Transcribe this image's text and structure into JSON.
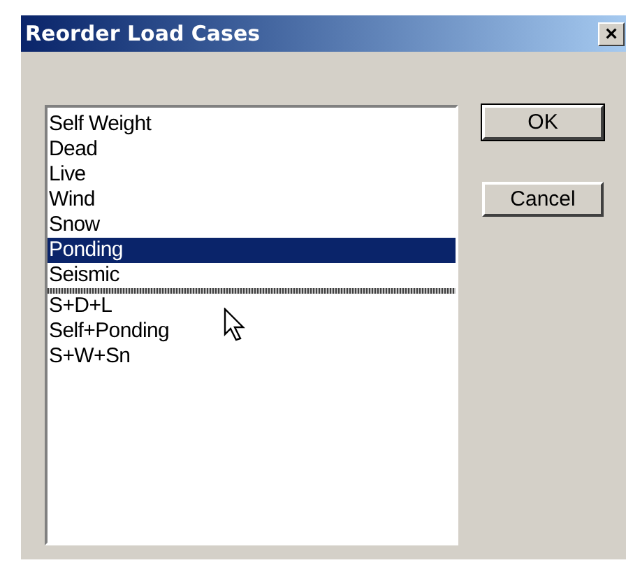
{
  "window": {
    "title": "Reorder Load Cases",
    "close": "×"
  },
  "list": {
    "items": [
      {
        "label": "Self Weight",
        "selected": false,
        "drop_after": false
      },
      {
        "label": "Dead",
        "selected": false,
        "drop_after": false
      },
      {
        "label": "Live",
        "selected": false,
        "drop_after": false
      },
      {
        "label": "Wind",
        "selected": false,
        "drop_after": false
      },
      {
        "label": "Snow",
        "selected": false,
        "drop_after": false
      },
      {
        "label": "Ponding",
        "selected": true,
        "drop_after": false
      },
      {
        "label": "Seismic",
        "selected": false,
        "drop_after": true
      },
      {
        "label": "S+D+L",
        "selected": false,
        "drop_after": false
      },
      {
        "label": "Self+Ponding",
        "selected": false,
        "drop_after": false
      },
      {
        "label": "S+W+Sn",
        "selected": false,
        "drop_after": false
      }
    ]
  },
  "buttons": [
    {
      "label": "OK",
      "default": true
    },
    {
      "label": "Cancel",
      "default": false
    }
  ]
}
